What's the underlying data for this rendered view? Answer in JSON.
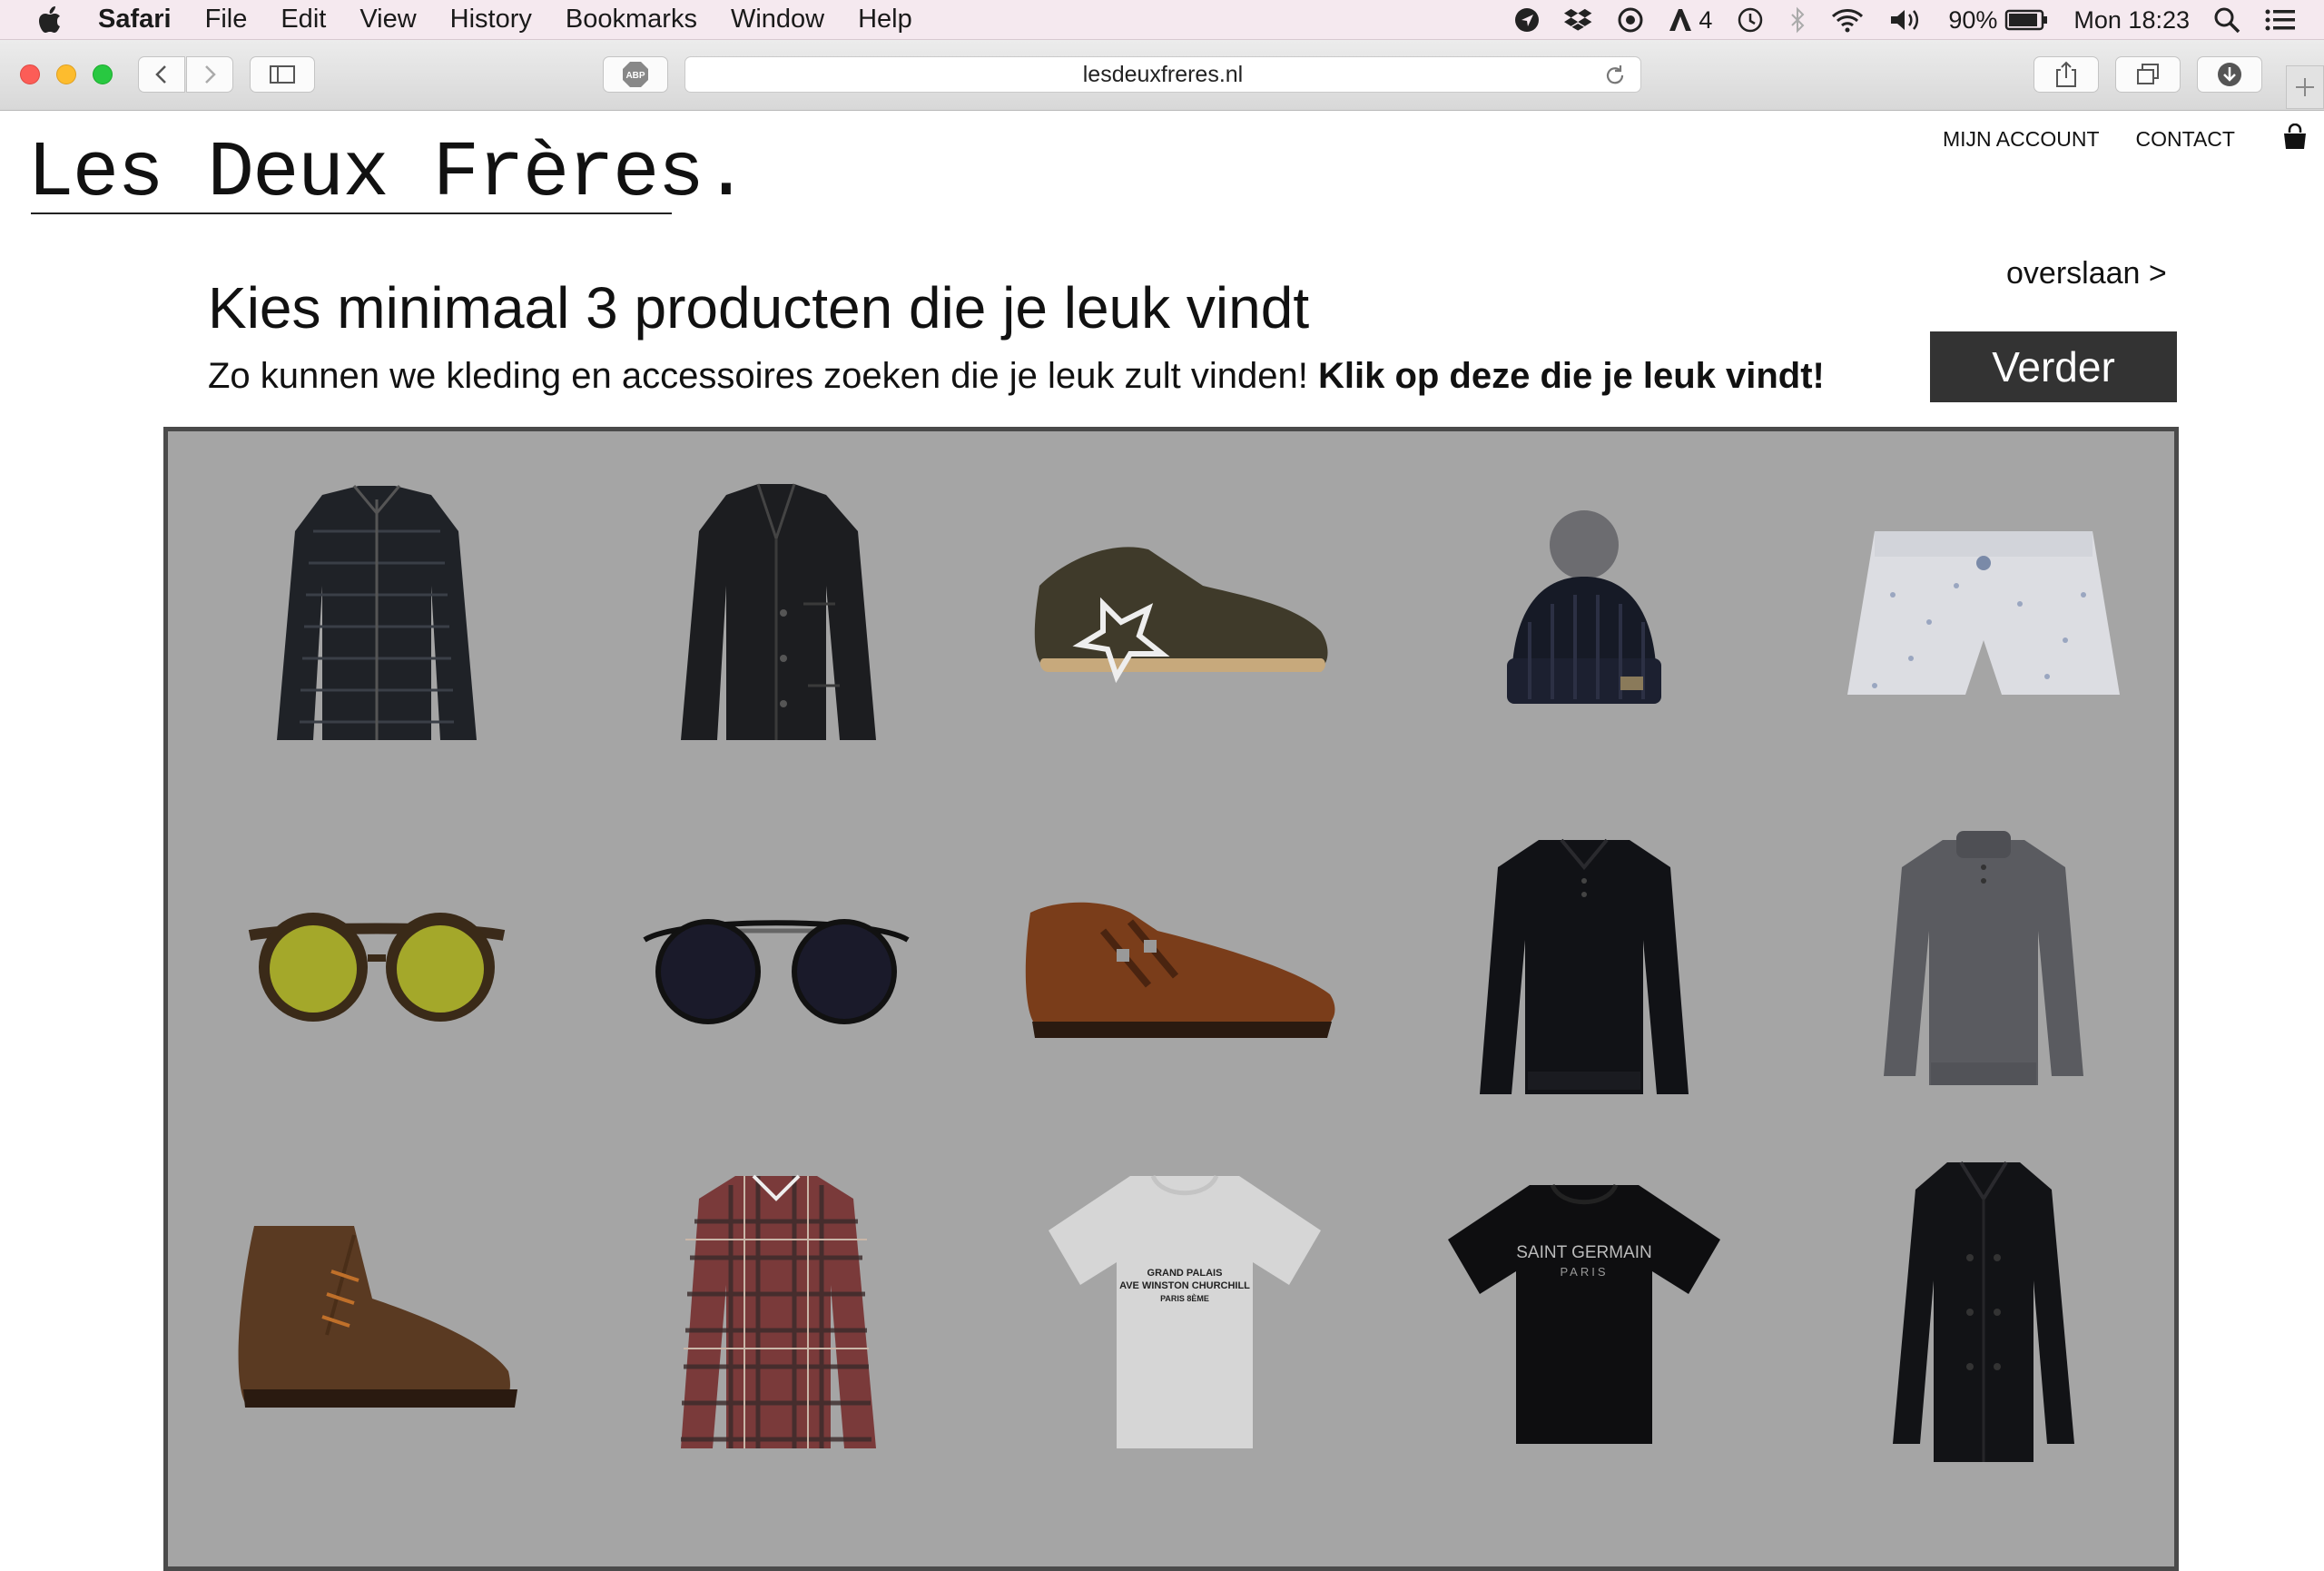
{
  "menubar": {
    "app": "Safari",
    "items": [
      "File",
      "Edit",
      "View",
      "History",
      "Bookmarks",
      "Window",
      "Help"
    ],
    "adobe_count": "4",
    "battery": "90%",
    "clock": "Mon 18:23"
  },
  "browser": {
    "url": "lesdeuxfreres.nl",
    "adblock_label": "ABP"
  },
  "site": {
    "logo": "Les Deux Frères.",
    "nav": [
      "MIJN ACCOUNT",
      "CONTACT"
    ],
    "skip": "overslaan >",
    "headline": "Kies minimaal 3 producten die je leuk vindt",
    "sub_text": "Zo kunnen we kleding en accessoires zoeken die je leuk zult vinden!",
    "sub_bold": "Klik op deze die je leuk vindt!",
    "button": "Verder"
  },
  "products": [
    {
      "name": "Puffer jacket",
      "icon": "puffer-jacket"
    },
    {
      "name": "Black jacket",
      "icon": "jacket"
    },
    {
      "name": "Star sneaker",
      "icon": "sneaker"
    },
    {
      "name": "Pompom beanie",
      "icon": "beanie"
    },
    {
      "name": "Boxer shorts",
      "icon": "shorts"
    },
    {
      "name": "Mirrored sunglasses",
      "icon": "sunglasses"
    },
    {
      "name": "Black sunglasses",
      "icon": "sunglasses"
    },
    {
      "name": "Monk strap shoe",
      "icon": "dress-shoe"
    },
    {
      "name": "Black sweater",
      "icon": "sweater"
    },
    {
      "name": "Grey sweater",
      "icon": "sweater"
    },
    {
      "name": "Suede chukka boot",
      "icon": "boot"
    },
    {
      "name": "Plaid shirt",
      "icon": "shirt"
    },
    {
      "name": "White T-shirt",
      "icon": "t-shirt",
      "print": [
        "GRAND PALAIS",
        "AVE WINSTON CHURCHILL",
        "PARIS 8ÈME"
      ]
    },
    {
      "name": "Black T-shirt",
      "icon": "t-shirt",
      "print": [
        "SAINT GERMAIN",
        "PARIS"
      ]
    },
    {
      "name": "Black coat",
      "icon": "coat"
    }
  ]
}
